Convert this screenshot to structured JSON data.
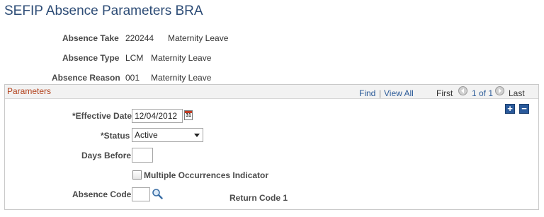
{
  "page": {
    "title": "SEFIP Absence Parameters BRA"
  },
  "summary": {
    "absence_take": {
      "label": "Absence Take",
      "code": "220244",
      "description": "Maternity Leave"
    },
    "absence_type": {
      "label": "Absence Type",
      "code": "LCM",
      "description": "Maternity Leave"
    },
    "absence_reason": {
      "label": "Absence Reason",
      "code": "001",
      "description": "Maternity Leave"
    }
  },
  "parameters": {
    "title": "Parameters",
    "nav": {
      "find": "Find",
      "separator": "|",
      "view_all": "View All",
      "first": "First",
      "range": "1 of 1",
      "last": "Last"
    },
    "add_row": "+",
    "delete_row": "−",
    "effective_date": {
      "label": "*Effective Date",
      "value": "12/04/2012",
      "calendar_glyph": "31"
    },
    "status": {
      "label": "*Status",
      "value": "Active"
    },
    "days_before": {
      "label": "Days Before",
      "value": ""
    },
    "multiple_occurrences": {
      "label": "Multiple Occurrences Indicator",
      "checked": false
    },
    "absence_code": {
      "label": "Absence Code",
      "value": ""
    },
    "return_code": {
      "label": "Return Code 1"
    }
  },
  "icons": {
    "calendar": "calendar-icon",
    "lookup": "magnifier-icon",
    "prev": "left-arrow-icon",
    "next": "right-arrow-icon"
  },
  "colors": {
    "title": "#2d4c76",
    "group_title": "#b2411c",
    "link": "#2d5c99",
    "button": "#2a5a9b"
  }
}
